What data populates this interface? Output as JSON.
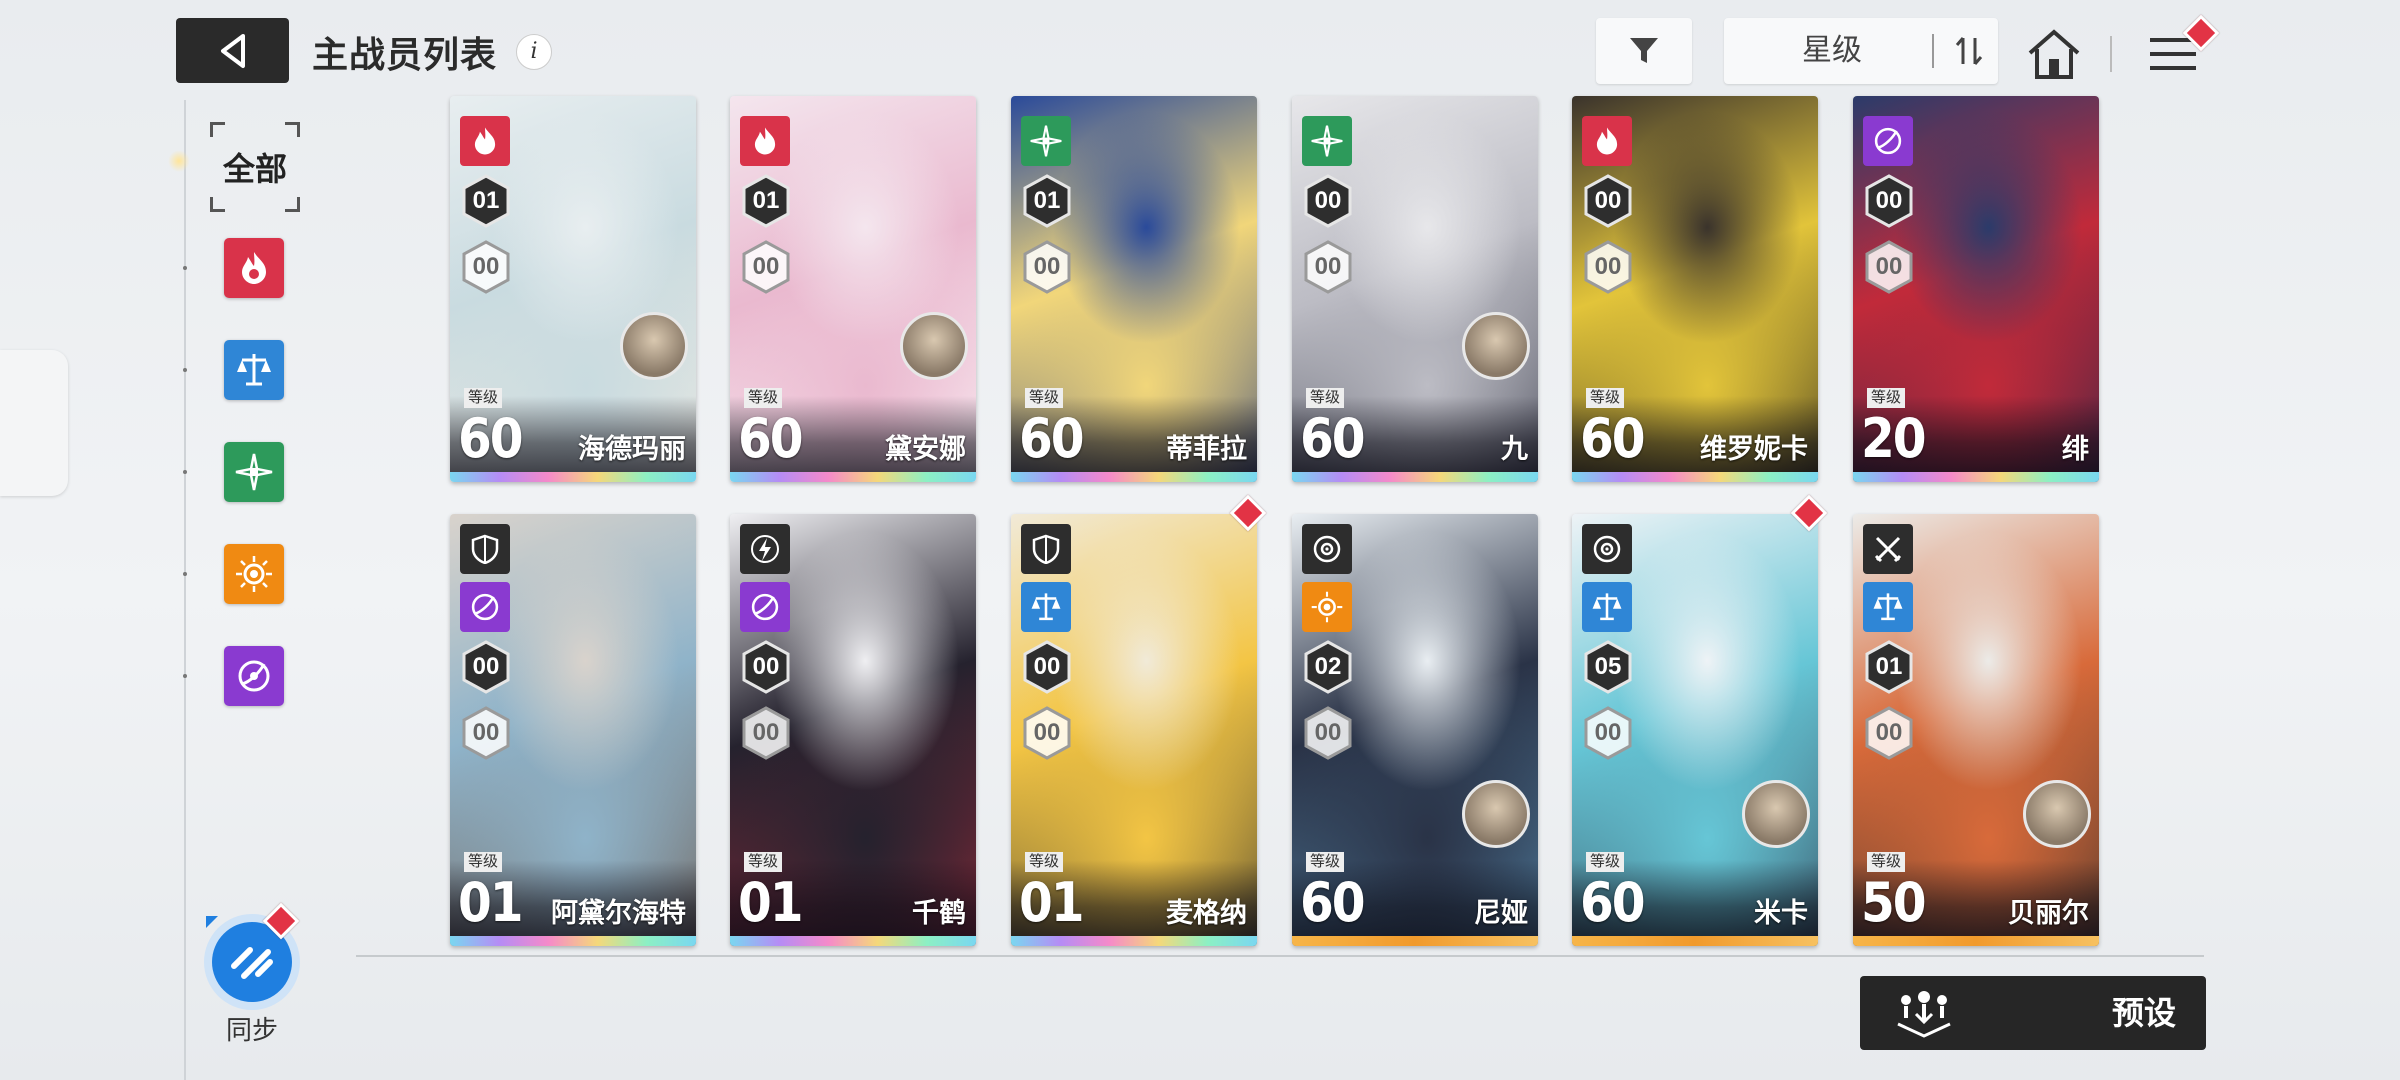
{
  "header": {
    "title": "主战员列表",
    "info_glyph": "i",
    "sort_label": "星级"
  },
  "sidebar": {
    "all_label": "全部",
    "element_filters": [
      {
        "name": "fire",
        "color": "#d9334a"
      },
      {
        "name": "balance",
        "color": "#2f86d6"
      },
      {
        "name": "wind",
        "color": "#2d9a5b"
      },
      {
        "name": "electric",
        "color": "#f08a12"
      },
      {
        "name": "void",
        "color": "#8a3ad0"
      }
    ],
    "sync_label": "同步"
  },
  "cards": [
    {
      "name": "海德玛丽",
      "level": "60",
      "level_tag": "等级",
      "rank": "01",
      "sub": "00",
      "element": "fire",
      "element_color": "#d9334a",
      "class_icon": "",
      "has_avatar": true,
      "new": false,
      "art": [
        "#e8eef0",
        "#c9dbe0",
        "#f3ece2"
      ],
      "band": "rainbow"
    },
    {
      "name": "黛安娜",
      "level": "60",
      "level_tag": "等级",
      "rank": "01",
      "sub": "00",
      "element": "fire",
      "element_color": "#d9334a",
      "class_icon": "",
      "has_avatar": true,
      "new": false,
      "art": [
        "#f4e6ee",
        "#eab9cf",
        "#ffffff"
      ],
      "band": "rainbow"
    },
    {
      "name": "蒂菲拉",
      "level": "60",
      "level_tag": "等级",
      "rank": "01",
      "sub": "00",
      "element": "wind",
      "element_color": "#2d9a5b",
      "class_icon": "",
      "has_avatar": false,
      "new": false,
      "art": [
        "#2a4a9a",
        "#f1d67a",
        "#1d3580"
      ],
      "band": "rainbow"
    },
    {
      "name": "九",
      "level": "60",
      "level_tag": "等级",
      "rank": "00",
      "sub": "00",
      "element": "wind",
      "element_color": "#2d9a5b",
      "class_icon": "",
      "has_avatar": true,
      "new": false,
      "art": [
        "#e7e7ea",
        "#bcbcc4",
        "#2e3140"
      ],
      "band": "rainbow"
    },
    {
      "name": "维罗妮卡",
      "level": "60",
      "level_tag": "等级",
      "rank": "00",
      "sub": "00",
      "element": "fire",
      "element_color": "#d9334a",
      "class_icon": "",
      "has_avatar": false,
      "new": false,
      "art": [
        "#3a332c",
        "#e2c43a",
        "#1f1c1a"
      ],
      "band": "rainbow"
    },
    {
      "name": "绯",
      "level": "20",
      "level_tag": "等级",
      "rank": "00",
      "sub": "00",
      "element": "void",
      "element_color": "#8a3ad0",
      "class_icon": "",
      "has_avatar": false,
      "new": false,
      "art": [
        "#2b3b6a",
        "#c12a3a",
        "#1a2347"
      ],
      "band": "rainbow"
    },
    {
      "name": "阿黛尔海特",
      "level": "01",
      "level_tag": "等级",
      "rank": "00",
      "sub": "00",
      "element": "void",
      "element_color": "#8a3ad0",
      "class_icon": "shield-icon",
      "has_avatar": false,
      "new": false,
      "art": [
        "#d9d3cc",
        "#8fb3c9",
        "#6a5142"
      ],
      "band": "rainbow"
    },
    {
      "name": "千鹤",
      "level": "01",
      "level_tag": "等级",
      "rank": "00",
      "sub": "00",
      "element": "void",
      "element_color": "#8a3ad0",
      "class_icon": "lightning-icon",
      "has_avatar": false,
      "new": false,
      "art": [
        "#efeff2",
        "#25222e",
        "#a02a3a"
      ],
      "band": "rainbow"
    },
    {
      "name": "麦格纳",
      "level": "01",
      "level_tag": "等级",
      "rank": "00",
      "sub": "00",
      "element": "balance",
      "element_color": "#2f86d6",
      "class_icon": "shield-icon",
      "has_avatar": false,
      "new": true,
      "art": [
        "#f1ead8",
        "#f3c544",
        "#2b2b2b"
      ],
      "band": "rainbow"
    },
    {
      "name": "尼娅",
      "level": "60",
      "level_tag": "等级",
      "rank": "02",
      "sub": "00",
      "element": "electric",
      "element_color": "#f08a12",
      "class_icon": "target-icon",
      "has_avatar": true,
      "new": false,
      "art": [
        "#e9eef2",
        "#2a3347",
        "#5a8fb3"
      ],
      "band": "gold"
    },
    {
      "name": "米卡",
      "level": "60",
      "level_tag": "等级",
      "rank": "05",
      "sub": "00",
      "element": "balance",
      "element_color": "#2f86d6",
      "class_icon": "target-icon",
      "has_avatar": true,
      "new": true,
      "art": [
        "#eef3f6",
        "#66c6d6",
        "#2a3245"
      ],
      "band": "gold"
    },
    {
      "name": "贝丽尔",
      "level": "50",
      "level_tag": "等级",
      "rank": "01",
      "sub": "00",
      "element": "balance",
      "element_color": "#2f86d6",
      "class_icon": "crossed-swords-icon",
      "has_avatar": true,
      "new": false,
      "art": [
        "#ecebe8",
        "#d86a3a",
        "#2d2a28"
      ],
      "band": "gold"
    }
  ],
  "footer": {
    "preset_label": "预设"
  },
  "colors": {
    "accent_dark": "#262626",
    "badge_red": "#e23345",
    "sync_blue": "#1f7fe0"
  }
}
